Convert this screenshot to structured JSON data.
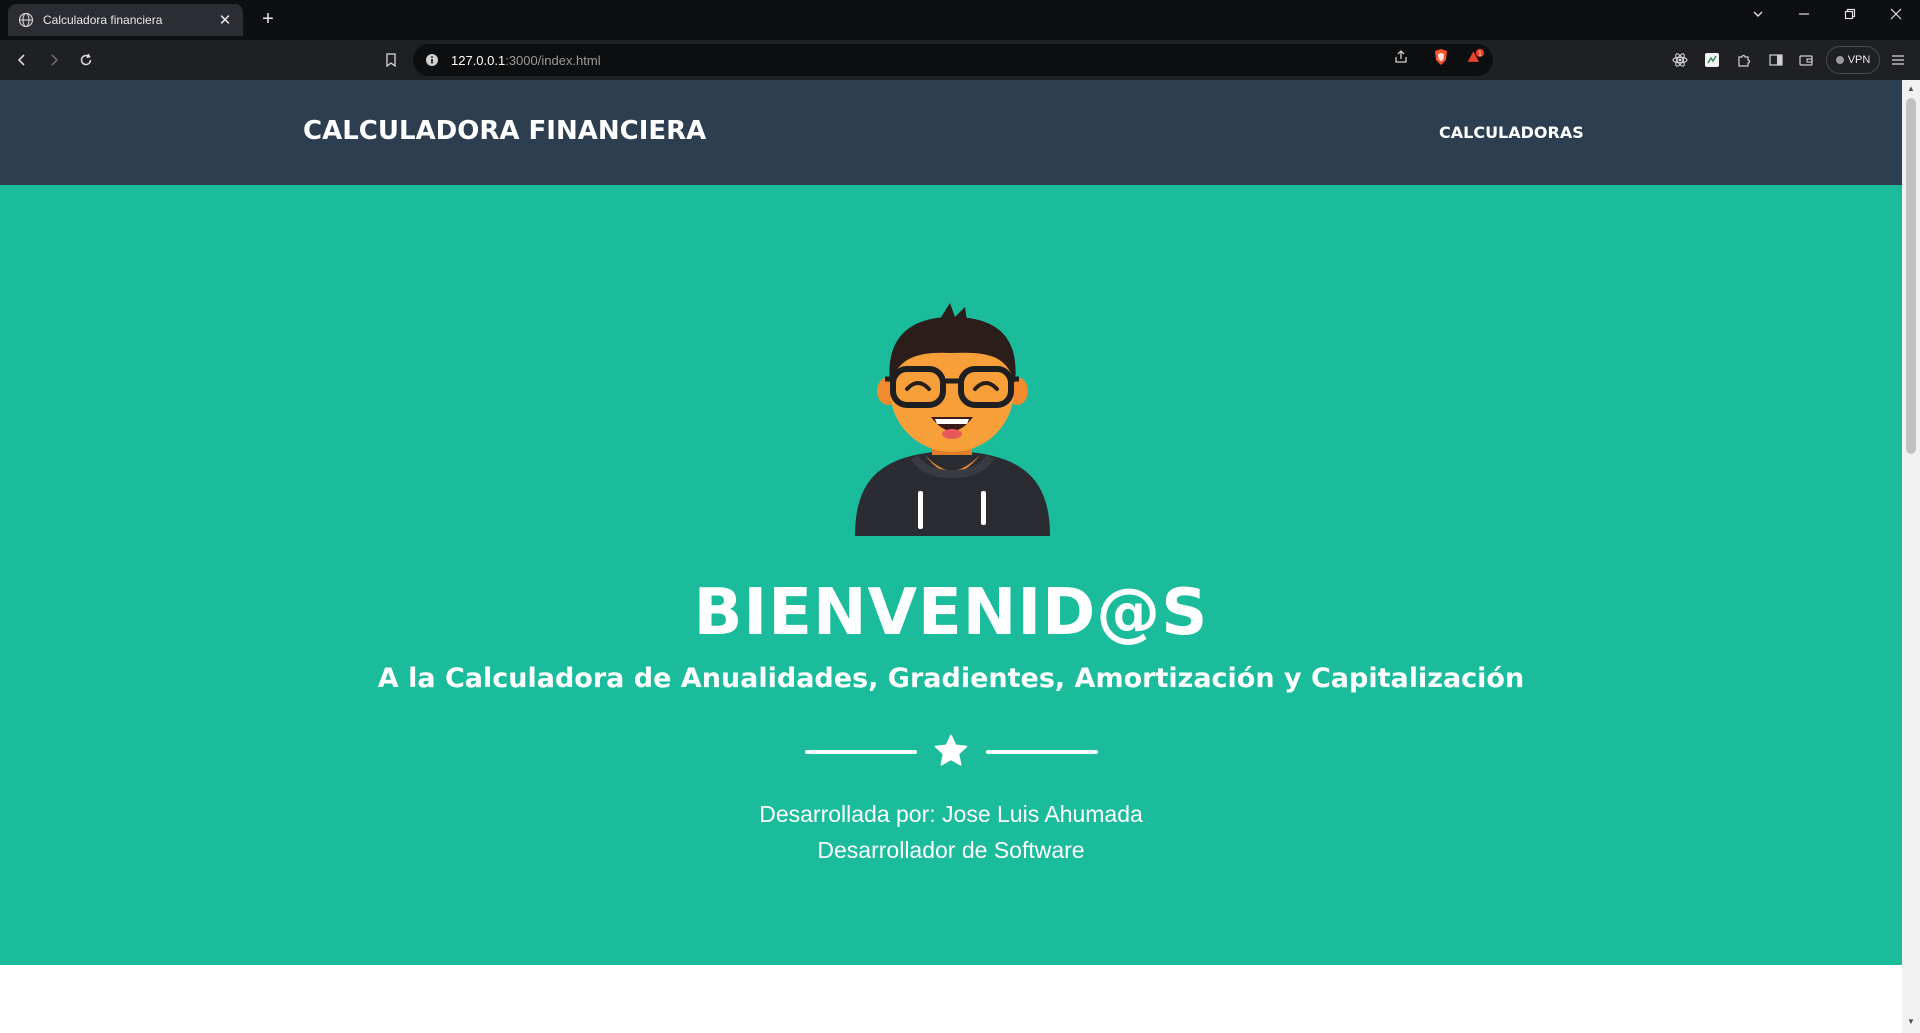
{
  "browser": {
    "tab_title": "Calculadora financiera",
    "url_host": "127.0.0.1",
    "url_rest": ":3000/index.html",
    "vpn_label": "VPN",
    "shield_badge": "1"
  },
  "page": {
    "brand": "CALCULADORA FINANCIERA",
    "nav_link": "CALCULADORAS",
    "heading": "BIENVENID@S",
    "subheading": "A la Calculadora de Anualidades, Gradientes, Amortización y Capitalización",
    "credit_line1": "Desarrollada por: Jose Luis Ahumada",
    "credit_line2": "Desarrollador de Software"
  },
  "colors": {
    "navbar": "#2c3e50",
    "masthead": "#1abc9c",
    "text": "#ffffff"
  },
  "icons": [
    "globe-icon",
    "close-icon",
    "plus-icon",
    "back-icon",
    "forward-icon",
    "reload-icon",
    "bookmark-icon",
    "info-icon",
    "share-icon",
    "brave-shield-icon",
    "brave-rewards-icon",
    "star-icon",
    "avatar"
  ]
}
